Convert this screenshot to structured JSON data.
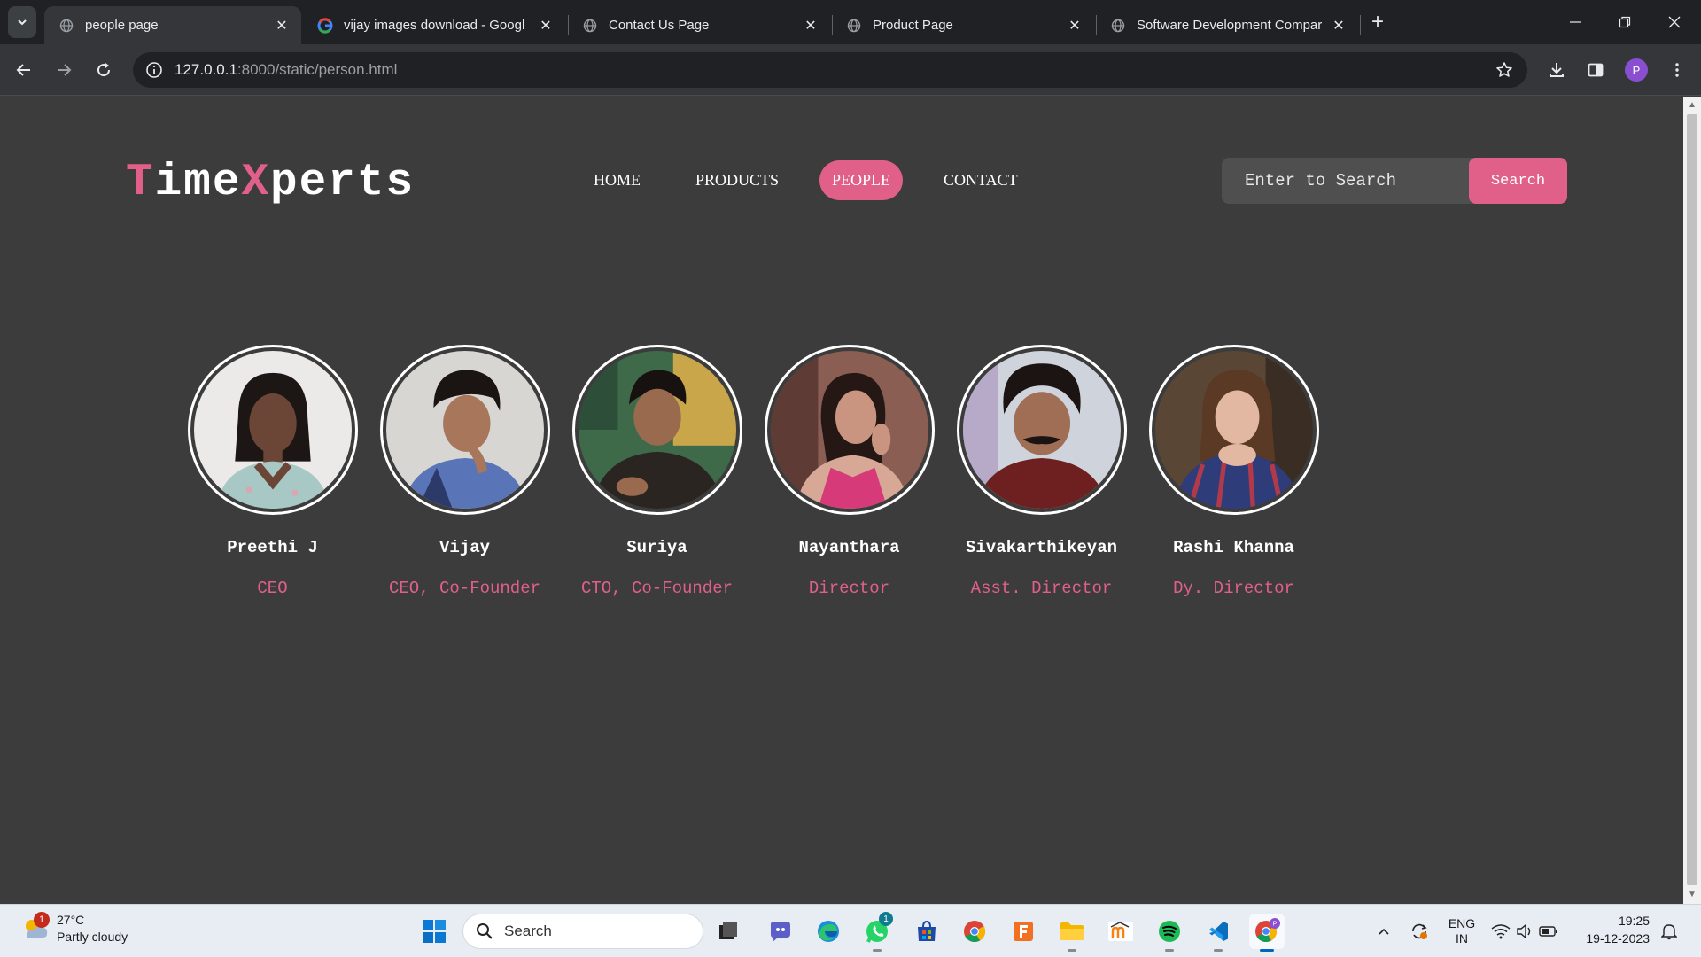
{
  "browser": {
    "tabs": [
      {
        "title": "people page",
        "active": true
      },
      {
        "title": "vijay images download - Googl",
        "active": false
      },
      {
        "title": "Contact Us Page",
        "active": false
      },
      {
        "title": "Product Page",
        "active": false
      },
      {
        "title": "Software Development Compar",
        "active": false
      }
    ],
    "url_host": "127.0.0.1",
    "url_rest": ":8000/static/person.html",
    "profile_initial": "P"
  },
  "site": {
    "logo": {
      "part1": "T",
      "part2": "ime",
      "part3": "X",
      "part4": "perts"
    },
    "nav": [
      "HOME",
      "PRODUCTS",
      "PEOPLE",
      "CONTACT"
    ],
    "active_nav": "PEOPLE",
    "search": {
      "placeholder": "Enter to Search",
      "button": "Search"
    },
    "accent_color": "#e0608a",
    "background_color": "#3c3c3c"
  },
  "people": [
    {
      "name": "Preethi J",
      "role": "CEO"
    },
    {
      "name": "Vijay",
      "role": "CEO, Co-Founder"
    },
    {
      "name": "Suriya",
      "role": "CTO, Co-Founder"
    },
    {
      "name": "Nayanthara",
      "role": "Director"
    },
    {
      "name": "Sivakarthikeyan",
      "role": "Asst. Director"
    },
    {
      "name": "Rashi Khanna",
      "role": "Dy. Director"
    }
  ],
  "taskbar": {
    "weather": {
      "temp": "27°C",
      "condition": "Partly cloudy",
      "badge": "1"
    },
    "search_label": "Search",
    "whatsapp_badge": "1",
    "language": "ENG",
    "region": "IN",
    "time": "19:25",
    "date": "19-12-2023"
  }
}
